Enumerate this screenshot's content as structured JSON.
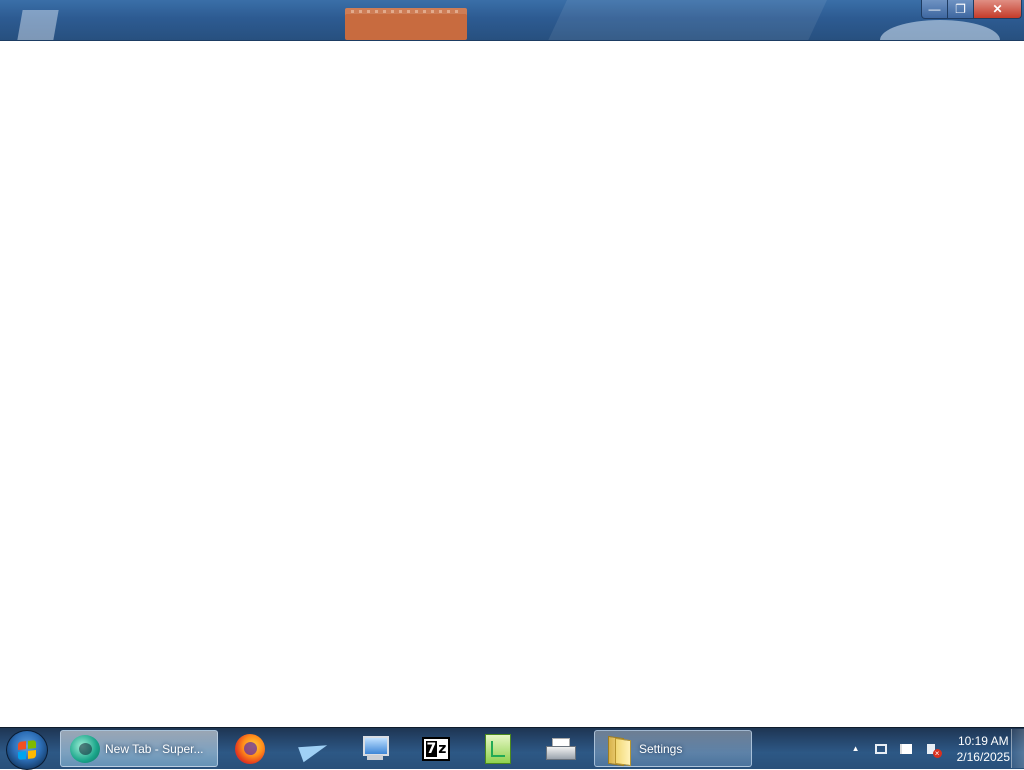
{
  "window": {
    "minimize_glyph": "—",
    "maximize_glyph": "❐",
    "close_glyph": "✕"
  },
  "taskbar": {
    "start_icon": "windows-start-orb",
    "items": [
      {
        "label": "New Tab - Super...",
        "icon": "browser-globe-icon",
        "active": true
      },
      {
        "label": "",
        "icon": "firefox-icon"
      },
      {
        "label": "",
        "icon": "plane-app-icon"
      },
      {
        "label": "",
        "icon": "computer-monitor-icon"
      },
      {
        "label": "7z",
        "icon": "7zip-icon"
      },
      {
        "label": "",
        "icon": "notepad-plus-plus-icon"
      },
      {
        "label": "",
        "icon": "printer-icon"
      },
      {
        "label": "Settings",
        "icon": "folder-icon"
      }
    ]
  },
  "tray": {
    "expand_glyph": "▲",
    "icons": [
      "network-icon",
      "action-center-flag-icon",
      "volume-muted-icon"
    ],
    "muted_glyph": "×",
    "time": "10:19 AM",
    "date": "2/16/2025"
  }
}
